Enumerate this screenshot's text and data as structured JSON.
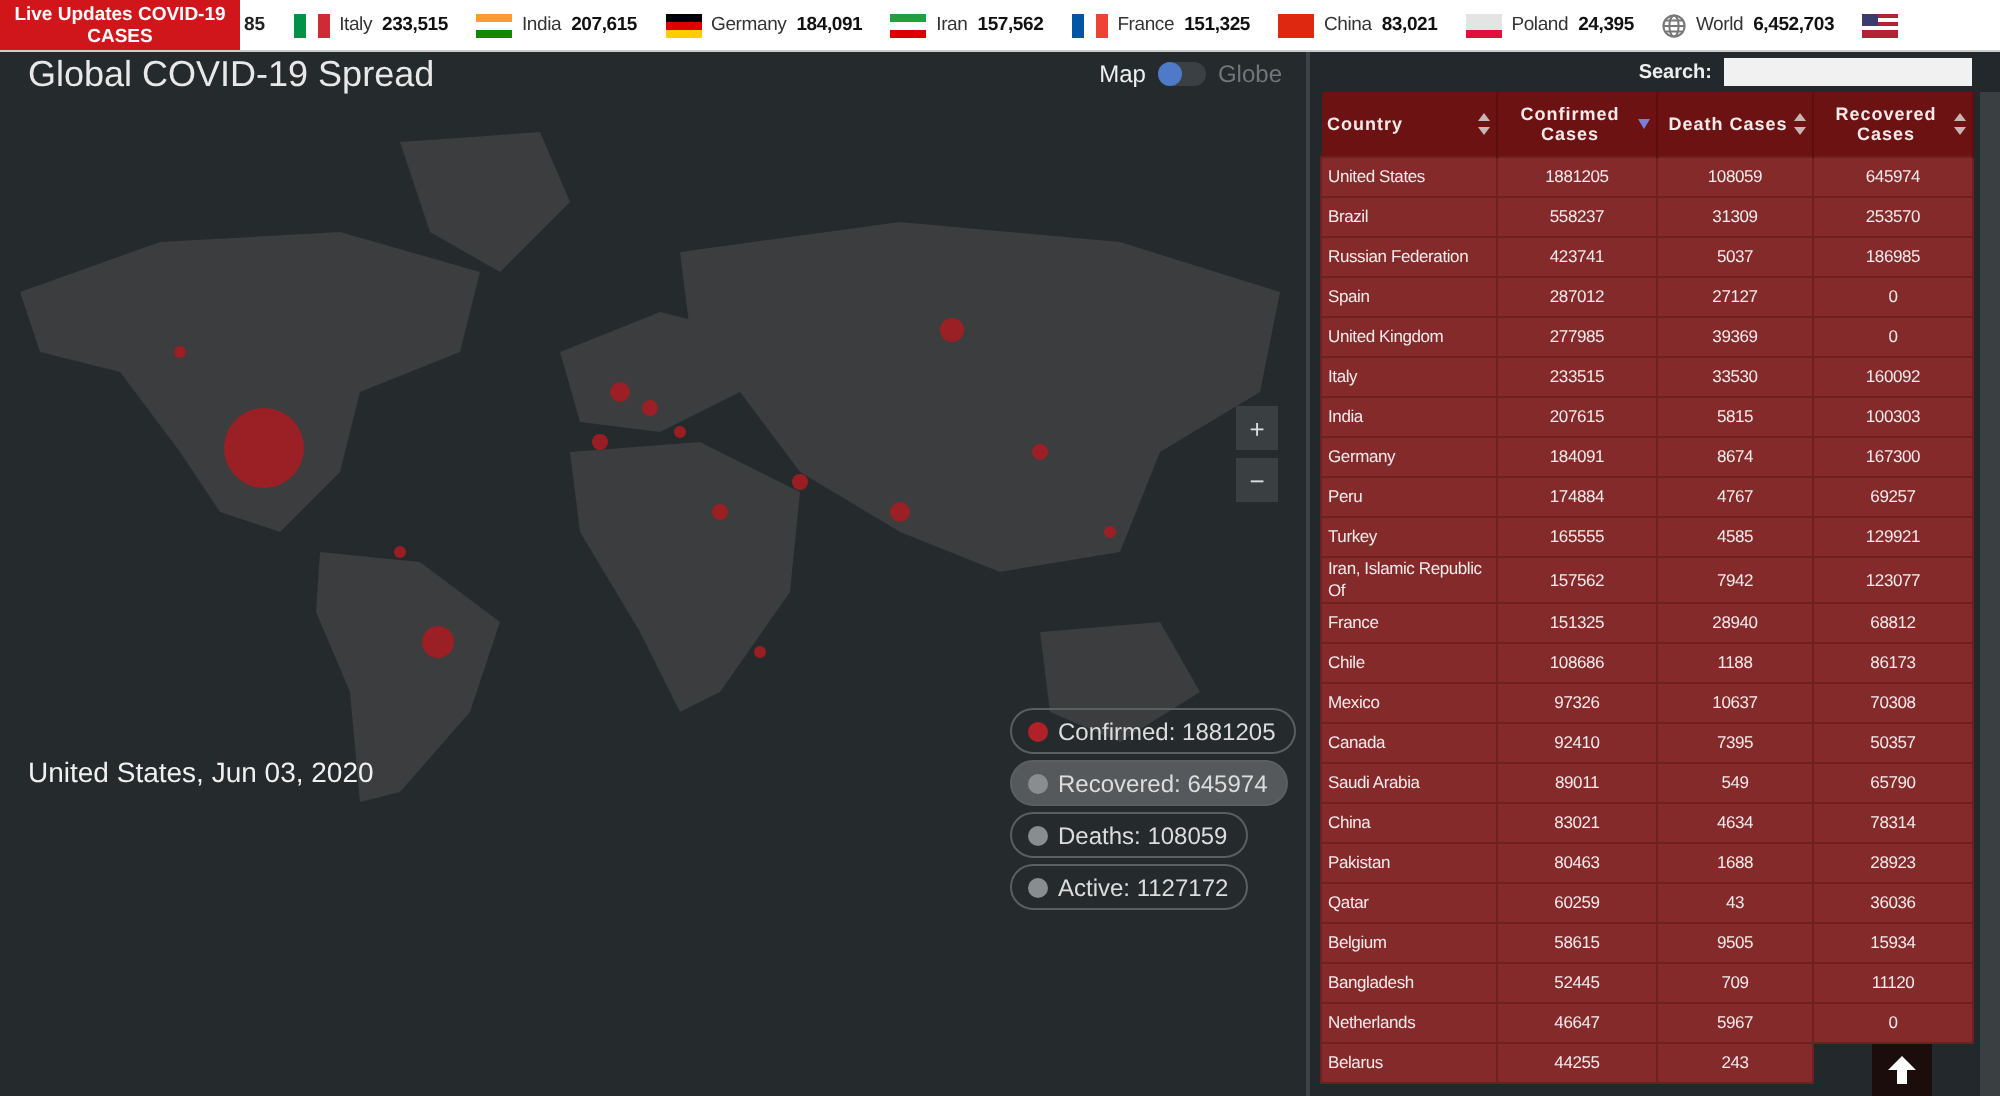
{
  "ticker": {
    "label": "Live Updates COVID-19 CASES",
    "cut_value": "85",
    "items": [
      {
        "kind": "flag",
        "name": "Italy",
        "value": "233,515"
      },
      {
        "kind": "flag",
        "name": "India",
        "value": "207,615"
      },
      {
        "kind": "flag",
        "name": "Germany",
        "value": "184,091"
      },
      {
        "kind": "flag",
        "name": "Iran",
        "value": "157,562"
      },
      {
        "kind": "flag",
        "name": "France",
        "value": "151,325"
      },
      {
        "kind": "flag",
        "name": "China",
        "value": "83,021"
      },
      {
        "kind": "flag",
        "name": "Poland",
        "value": "24,395"
      },
      {
        "kind": "globe",
        "name": "World",
        "value": "6,452,703"
      }
    ]
  },
  "map_panel": {
    "title": "Global COVID-19 Spread",
    "view_toggle": [
      {
        "label": "Map",
        "selected": true
      },
      {
        "label": "Globe",
        "selected": false
      }
    ],
    "zoom_controls": [
      "+",
      "−"
    ],
    "caption": "United States, Jun 03, 2020",
    "legend": [
      {
        "label": "Confirmed: 1881205",
        "color": "#b0212a",
        "selected": false
      },
      {
        "label": "Recovered: 645974",
        "color": "#8a8d90",
        "selected": true
      },
      {
        "label": "Deaths: 108059",
        "color": "#8a8d90",
        "selected": false
      },
      {
        "label": "Active: 1127172",
        "color": "#8a8d90",
        "selected": false
      }
    ]
  },
  "table": {
    "search_label": "Search:",
    "columns": [
      {
        "label": "Country",
        "sorted": false
      },
      {
        "label": "Confirmed Cases",
        "sorted": true
      },
      {
        "label": "Death Cases",
        "sorted": false
      },
      {
        "label": "Recovered Cases",
        "sorted": false
      }
    ],
    "rows": [
      [
        "United States",
        "1881205",
        "108059",
        "645974"
      ],
      [
        "Brazil",
        "558237",
        "31309",
        "253570"
      ],
      [
        "Russian Federation",
        "423741",
        "5037",
        "186985"
      ],
      [
        "Spain",
        "287012",
        "27127",
        "0"
      ],
      [
        "United Kingdom",
        "277985",
        "39369",
        "0"
      ],
      [
        "Italy",
        "233515",
        "33530",
        "160092"
      ],
      [
        "India",
        "207615",
        "5815",
        "100303"
      ],
      [
        "Germany",
        "184091",
        "8674",
        "167300"
      ],
      [
        "Peru",
        "174884",
        "4767",
        "69257"
      ],
      [
        "Turkey",
        "165555",
        "4585",
        "129921"
      ],
      [
        "Iran, Islamic Republic Of",
        "157562",
        "7942",
        "123077"
      ],
      [
        "France",
        "151325",
        "28940",
        "68812"
      ],
      [
        "Chile",
        "108686",
        "1188",
        "86173"
      ],
      [
        "Mexico",
        "97326",
        "10637",
        "70308"
      ],
      [
        "Canada",
        "92410",
        "7395",
        "50357"
      ],
      [
        "Saudi Arabia",
        "89011",
        "549",
        "65790"
      ],
      [
        "China",
        "83021",
        "4634",
        "78314"
      ],
      [
        "Pakistan",
        "80463",
        "1688",
        "28923"
      ],
      [
        "Qatar",
        "60259",
        "43",
        "36036"
      ],
      [
        "Belgium",
        "58615",
        "9505",
        "15934"
      ],
      [
        "Bangladesh",
        "52445",
        "709",
        "11120"
      ],
      [
        "Netherlands",
        "46647",
        "5967",
        "0"
      ],
      [
        "Belarus",
        "44255",
        "243"
      ]
    ]
  }
}
